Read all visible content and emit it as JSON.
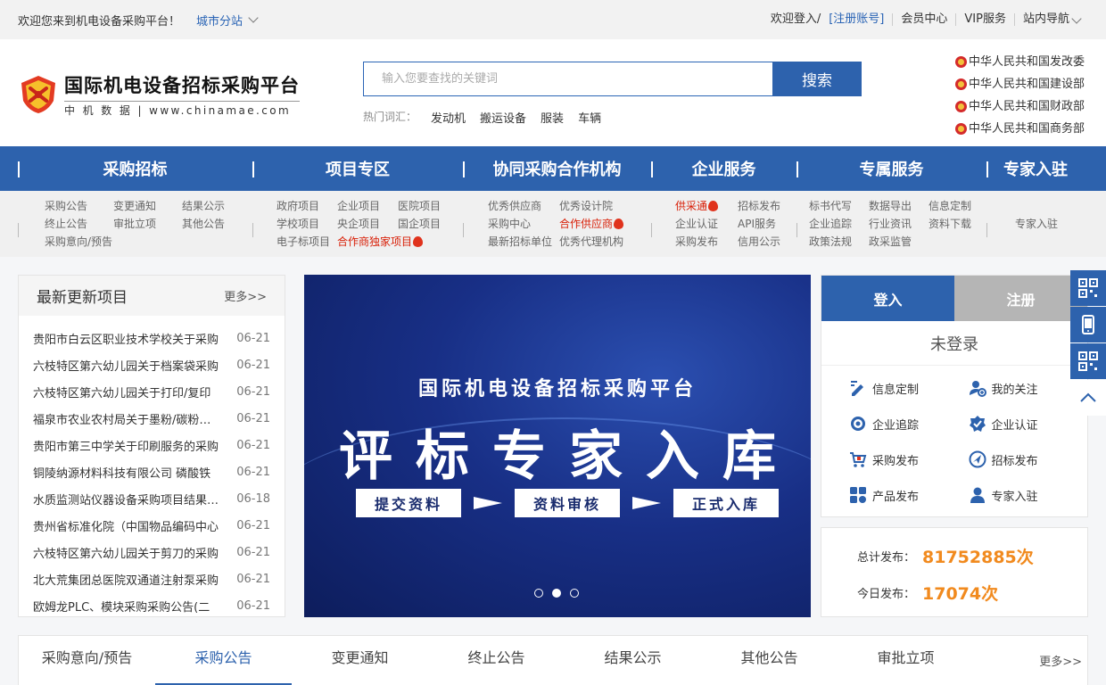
{
  "topbar": {
    "welcome": "欢迎您来到机电设备采购平台！",
    "city": "城市分站",
    "login_welcome": "欢迎登入/",
    "register": "[注册账号]",
    "member": "会员中心",
    "vip": "VIP服务",
    "sitenav": "站内导航"
  },
  "logo": {
    "title": "国际机电设备招标采购平台",
    "subtitle": "中 机 数 据 | www.chinamae.com"
  },
  "search": {
    "placeholder": "输入您要查找的关键词",
    "button": "搜索",
    "hot_label": "热门词汇：",
    "hot": [
      "发动机",
      "搬运设备",
      "服装",
      "车辆"
    ]
  },
  "gov_links": [
    "中华人民共和国发改委",
    "中华人民共和国建设部",
    "中华人民共和国财政部",
    "中华人民共和国商务部"
  ],
  "mainnav": [
    "采购招标",
    "项目专区",
    "协同采购合作机构",
    "企业服务",
    "专属服务",
    "专家入驻"
  ],
  "subnav": {
    "g1": [
      "采购公告",
      "变更通知",
      "结果公示",
      "终止公告",
      "审批立项",
      "其他公告",
      "采购意向/预告"
    ],
    "g2": [
      "政府项目",
      "企业项目",
      "医院项目",
      "学校项目",
      "央企项目",
      "国企项目",
      "电子标项目",
      "合作商独家项目"
    ],
    "g3": [
      "优秀供应商",
      "优秀设计院",
      "采购中心",
      "合作供应商",
      "最新招标单位",
      "优秀代理机构"
    ],
    "g4": [
      "供采通",
      "招标发布",
      "企业认证",
      "API服务",
      "采购发布",
      "信用公示"
    ],
    "g5": [
      "标书代写",
      "数据导出",
      "信息定制",
      "企业追踪",
      "行业资讯",
      "资料下载",
      "政策法规",
      "政采监管"
    ],
    "g6": [
      "专家入驻"
    ]
  },
  "latest": {
    "title": "最新更新项目",
    "more": "更多>>",
    "items": [
      {
        "text": "贵阳市白云区职业技术学校关于采购",
        "date": "06-21"
      },
      {
        "text": "六枝特区第六幼儿园关于档案袋采购",
        "date": "06-21"
      },
      {
        "text": "六枝特区第六幼儿园关于打印/复印",
        "date": "06-21"
      },
      {
        "text": "福泉市农业农村局关于墨粉/碳粉采购",
        "date": "06-21"
      },
      {
        "text": "贵阳市第三中学关于印刷服务的采购",
        "date": "06-21"
      },
      {
        "text": "铜陵纳源材料科技有限公司 磷酸铁",
        "date": "06-21"
      },
      {
        "text": "水质监测站仪器设备采购项目结果公告",
        "date": "06-18"
      },
      {
        "text": "贵州省标准化院（中国物品编码中心",
        "date": "06-21"
      },
      {
        "text": "六枝特区第六幼儿园关于剪刀的采购",
        "date": "06-21"
      },
      {
        "text": "北大荒集团总医院双通道注射泵采购",
        "date": "06-21"
      },
      {
        "text": "欧姆龙PLC、模块采购采购公告(二",
        "date": "06-21"
      }
    ]
  },
  "banner": {
    "sub": "国际机电设备招标采购平台",
    "big": "评标专家入库",
    "steps": [
      "提交资料",
      "资料审核",
      "正式入库"
    ],
    "active_dot": 1
  },
  "login": {
    "tab_login": "登入",
    "tab_register": "注册",
    "status": "未登录",
    "items": [
      {
        "label": "信息定制",
        "icon": "custom-info-icon"
      },
      {
        "label": "我的关注",
        "icon": "follow-icon"
      },
      {
        "label": "企业追踪",
        "icon": "track-icon"
      },
      {
        "label": "企业认证",
        "icon": "certify-icon"
      },
      {
        "label": "采购发布",
        "icon": "cart-icon"
      },
      {
        "label": "招标发布",
        "icon": "bid-icon"
      },
      {
        "label": "产品发布",
        "icon": "product-icon"
      },
      {
        "label": "专家入驻",
        "icon": "expert-icon"
      }
    ]
  },
  "stats": {
    "total_label": "总计发布：",
    "total_value": "81752885次",
    "today_label": "今日发布：",
    "today_value": "17074次"
  },
  "bottom_tabs": {
    "tabs": [
      "采购意向/预告",
      "采购公告",
      "变更通知",
      "终止公告",
      "结果公示",
      "其他公告",
      "审批立项"
    ],
    "active": 1,
    "more": "更多>>"
  },
  "colors": {
    "brand_blue": "#2d62ad",
    "accent_orange": "#f18a1e",
    "hot_red": "#d81e06"
  }
}
